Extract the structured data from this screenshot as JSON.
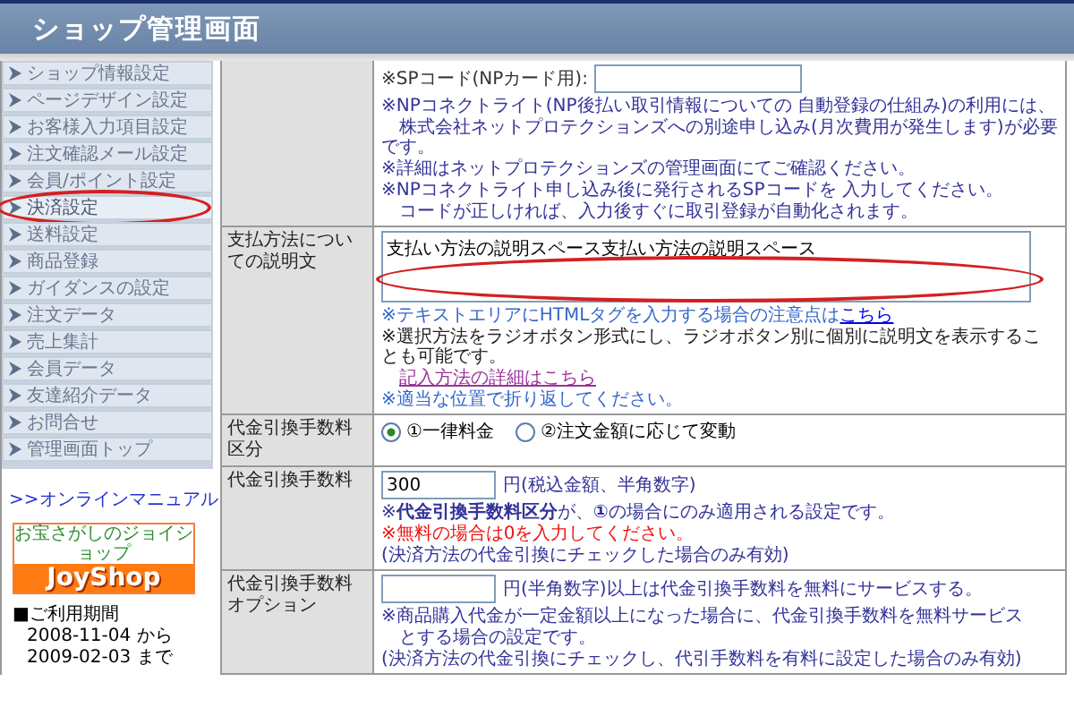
{
  "header": {
    "title": "ショップ管理画面"
  },
  "sidebar": {
    "items": [
      {
        "label": "ショップ情報設定",
        "selected": false,
        "circled": false
      },
      {
        "label": "ページデザイン設定",
        "selected": false,
        "circled": false
      },
      {
        "label": "お客様入力項目設定",
        "selected": false,
        "circled": false
      },
      {
        "label": "注文確認メール設定",
        "selected": false,
        "circled": false
      },
      {
        "label": "会員/ポイント設定",
        "selected": false,
        "circled": false
      },
      {
        "label": "決済設定",
        "selected": true,
        "circled": true
      },
      {
        "label": "送料設定",
        "selected": false,
        "circled": false
      },
      {
        "label": "商品登録",
        "selected": false,
        "circled": false
      },
      {
        "label": "ガイダンスの設定",
        "selected": false,
        "circled": false
      },
      {
        "label": "注文データ",
        "selected": false,
        "circled": false
      },
      {
        "label": "売上集計",
        "selected": false,
        "circled": false
      },
      {
        "label": "会員データ",
        "selected": false,
        "circled": false
      },
      {
        "label": "友達紹介データ",
        "selected": false,
        "circled": false
      },
      {
        "label": "お問合せ",
        "selected": false,
        "circled": false
      },
      {
        "label": "管理画面トップ",
        "selected": false,
        "circled": false
      }
    ],
    "manual_link": ">>オンラインマニュアル",
    "logo": {
      "tagline": "お宝さがしのジョイショップ",
      "name": "JoyShop"
    },
    "period": {
      "heading": "■ご利用期間",
      "lines": [
        "2008-11-04 から",
        "2009-02-03 まで"
      ]
    }
  },
  "form": {
    "rows": [
      {
        "kind": "code",
        "circled": false,
        "field_label": "※SPコード(NPカード用):",
        "notes": [
          {
            "kind": "note",
            "text": "※NPコネクトライト(NP後払い取引情報についての 自動登録の仕組み)の利用には、"
          },
          {
            "kind": "note",
            "text": "　株式会社ネットプロテクションズへの別途申し込み(月次費用が発生します)が必要です。"
          },
          {
            "kind": "note",
            "text": "※詳細はネットプロテクションズの管理画面にてご確認ください。"
          },
          {
            "kind": "note",
            "text": "※NPコネクトライト申し込み後に発行されるSPコードを 入力してください。"
          },
          {
            "kind": "note",
            "text": "　コードが正しければ、入力後すぐに取引登録が自動化されます。"
          }
        ]
      },
      {
        "kind": "textarea",
        "label": "支払方法についての説明文",
        "circled": true,
        "value": "支払い方法の説明スペース支払い方法の説明スペース",
        "notes": [
          {
            "kind": "info",
            "text": "※テキストエリアにHTMLタグを入力する場合の注意点は",
            "link": "こちら"
          },
          {
            "kind": "plain",
            "text": "※選択方法をラジオボタン形式にし、ラジオボタン別に個別に説明文を表示することも可能です。"
          },
          {
            "kind": "link",
            "text": "記入方法の詳細はこちら"
          },
          {
            "kind": "info",
            "text": "※適当な位置で折り返してください。"
          }
        ]
      },
      {
        "kind": "radio",
        "label": "代金引換手数料区分",
        "circled": false,
        "options": [
          {
            "label": "①一律料金",
            "selected": true
          },
          {
            "label": "②注文金額に応じて変動",
            "selected": false
          }
        ]
      },
      {
        "kind": "amount",
        "label": "代金引換手数料",
        "circled": false,
        "value": "300",
        "unit": "円(税込金額、半角数字)",
        "notes": [
          {
            "kind": "note",
            "text": "※**代金引換手数料区分**が、**①**の場合にのみ適用される設定です。"
          },
          {
            "kind": "warning",
            "text": "※無料の場合は0を入力してください。"
          },
          {
            "kind": "note",
            "text": "(決済方法の代金引換にチェックした場合のみ有効)"
          }
        ]
      },
      {
        "kind": "amount",
        "label": "代金引換手数料オプション",
        "circled": false,
        "unit": "円(半角数字)以上は代金引換手数料を無料にサービスする。",
        "notes": [
          {
            "kind": "note",
            "text": "※商品購入代金が一定金額以上になった場合に、代金引換手数料を無料サービス"
          },
          {
            "kind": "note",
            "text": "　とする場合の設定です。"
          },
          {
            "kind": "note",
            "text": "(決済方法の代金引換にチェックし、代引手数料を有料に設定した場合のみ有効)"
          }
        ]
      }
    ]
  }
}
